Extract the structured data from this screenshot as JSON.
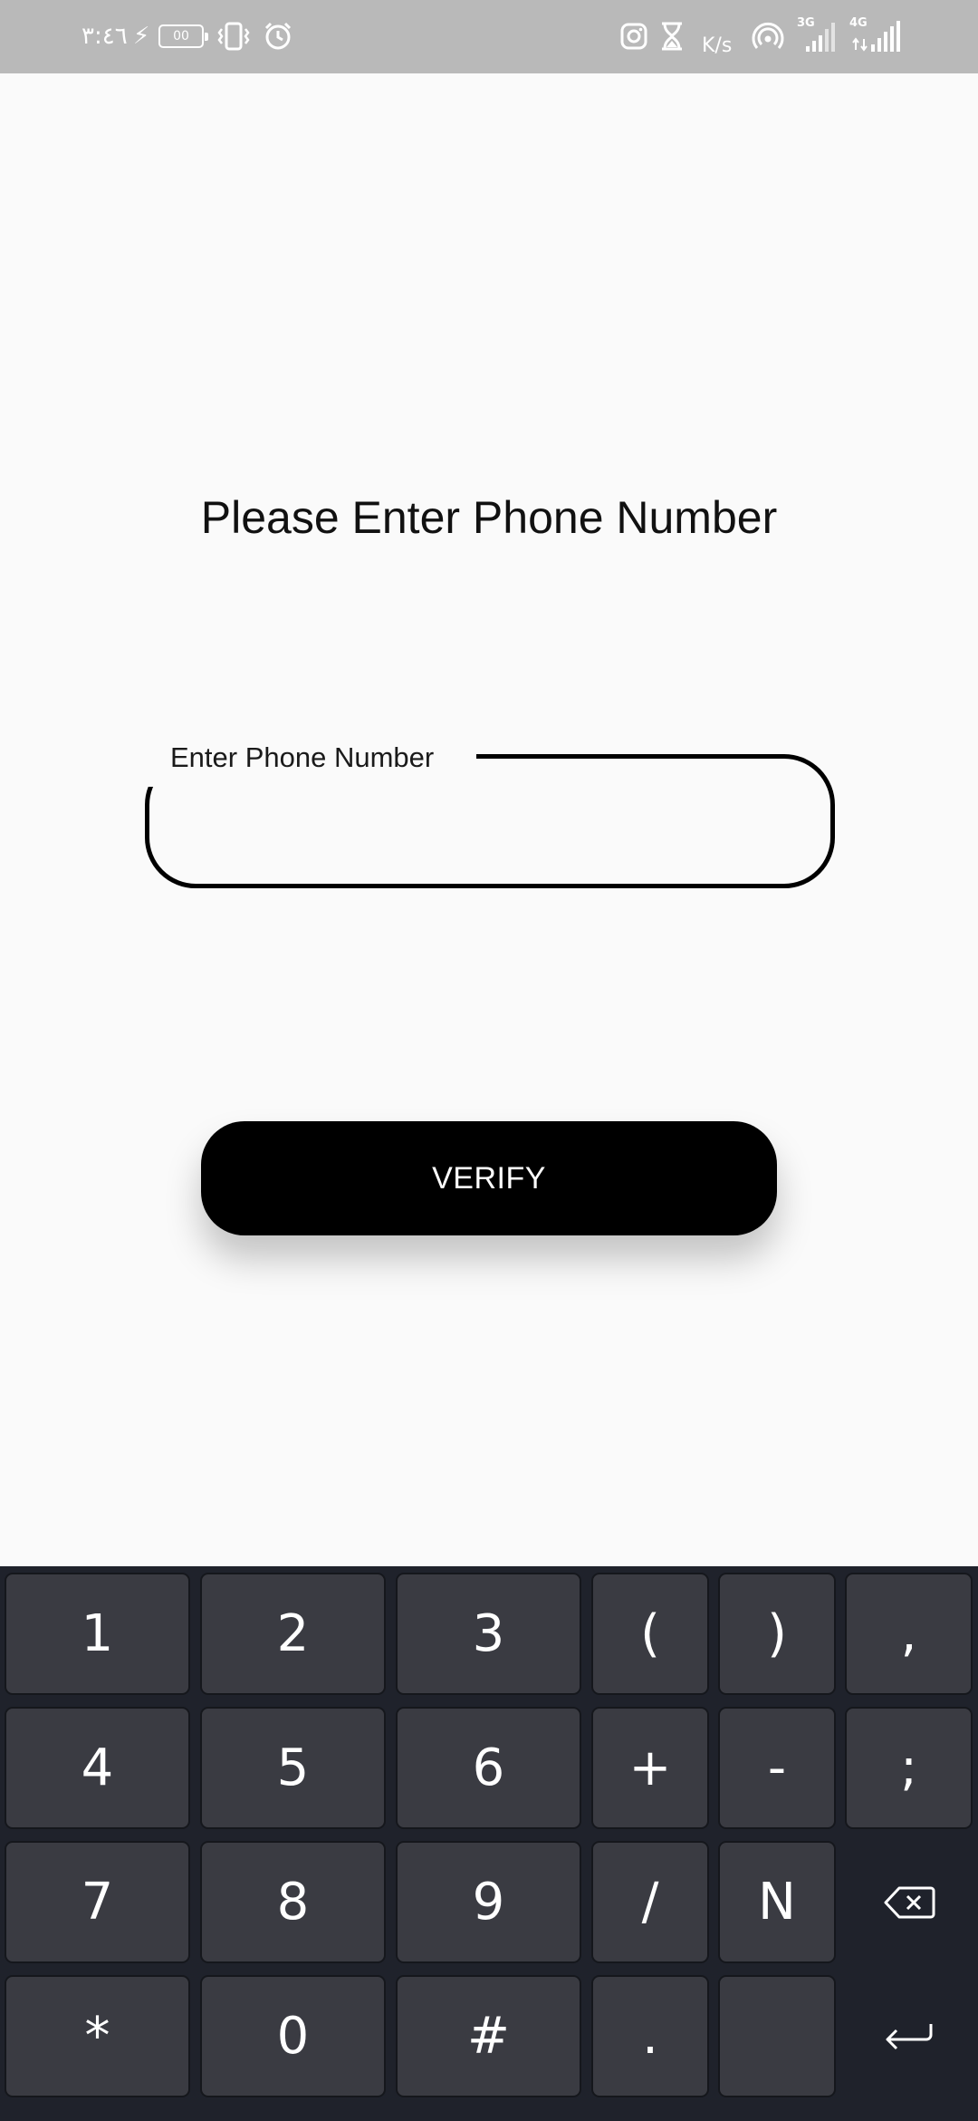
{
  "status_bar": {
    "time": "٣:٤٦",
    "battery": "00",
    "network_speed": "K/s",
    "signal1_label": "3G",
    "signal2_label": "4G",
    "icons": [
      "charging-icon",
      "battery-icon",
      "vibrate-icon",
      "alarm-icon",
      "instagram-icon",
      "hourglass-icon",
      "hotspot-icon",
      "signal-3g-icon",
      "signal-4g-icon"
    ]
  },
  "main": {
    "title": "Please Enter Phone Number",
    "phone_field": {
      "label": "Enter Phone Number",
      "value": "",
      "placeholder": ""
    },
    "verify_label": "VERIFY"
  },
  "keyboard": {
    "rows": [
      [
        "1",
        "2",
        "3",
        "(",
        ")",
        ","
      ],
      [
        "4",
        "5",
        "6",
        "+",
        "-",
        ";"
      ],
      [
        "7",
        "8",
        "9",
        "/",
        "N",
        "backspace"
      ],
      [
        "*",
        "0",
        "#",
        ".",
        "",
        "enter"
      ]
    ],
    "icons": {
      "backspace": "backspace-icon",
      "enter": "enter-icon"
    }
  },
  "colors": {
    "background": "#fafafa",
    "button": "#000000",
    "keyboard": "#1f222b",
    "key": "#3a3b42",
    "status_bar": "#b9b9b9"
  }
}
